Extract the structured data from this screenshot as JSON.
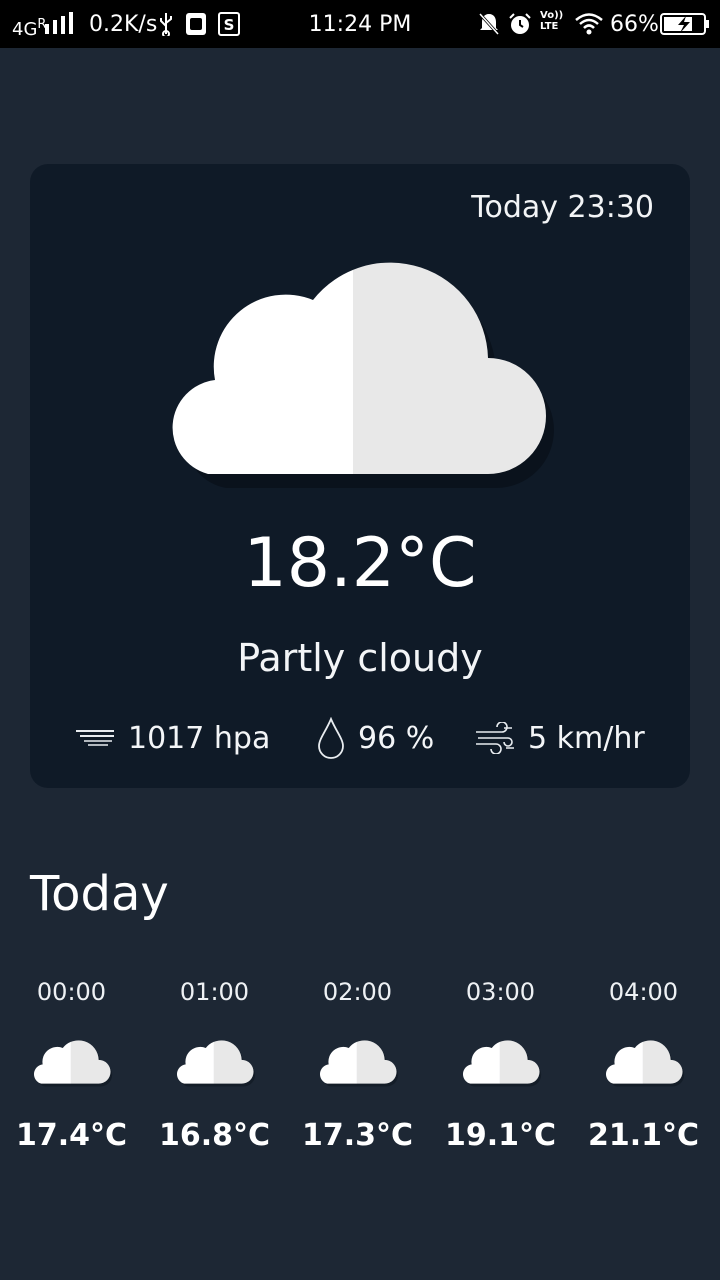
{
  "status_bar": {
    "network": "4G",
    "network_roaming": "R",
    "speed": "0.2K/s",
    "time": "11:24 PM",
    "battery": "66%",
    "volte": "Vo)) LTE"
  },
  "current": {
    "updated": "Today 23:30",
    "temperature": "18.2°C",
    "condition": "Partly cloudy",
    "condition_icon": "cloud-icon",
    "pressure": "1017 hpa",
    "humidity": "96 %",
    "wind": "5 km/hr"
  },
  "today": {
    "title": "Today",
    "hours": [
      {
        "time": "00:00",
        "temp": "17.4°C",
        "icon": "cloud-icon"
      },
      {
        "time": "01:00",
        "temp": "16.8°C",
        "icon": "cloud-icon"
      },
      {
        "time": "02:00",
        "temp": "17.3°C",
        "icon": "cloud-icon"
      },
      {
        "time": "03:00",
        "temp": "19.1°C",
        "icon": "cloud-icon"
      },
      {
        "time": "04:00",
        "temp": "21.1°C",
        "icon": "cloud-icon"
      }
    ]
  },
  "colors": {
    "background": "#1d2734",
    "card": "#0f1a27",
    "cloud_light": "#ffffff",
    "cloud_shade": "#e8e8e8"
  }
}
